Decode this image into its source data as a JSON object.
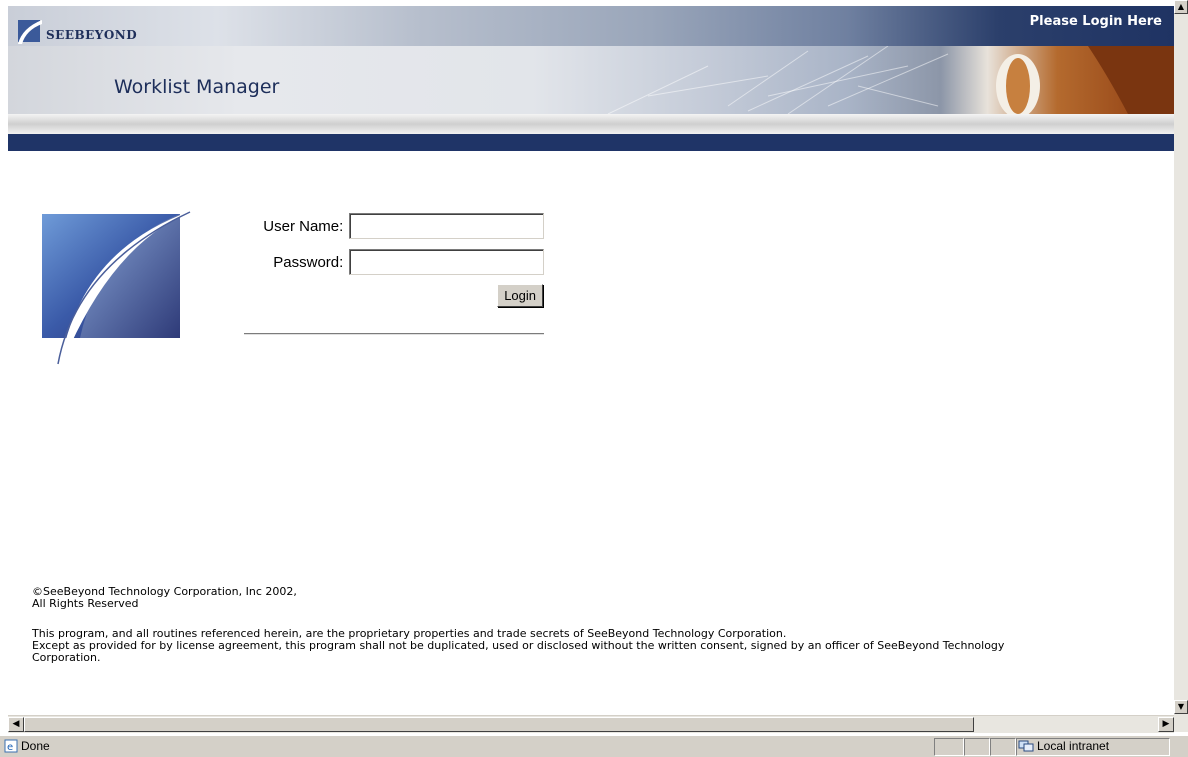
{
  "header": {
    "brand": "SEEBEYOND",
    "login_prompt": "Please Login Here",
    "app_title": "Worklist Manager"
  },
  "login_form": {
    "username_label": "User Name:",
    "username_value": "",
    "password_label": "Password:",
    "password_value": "",
    "login_button": "Login"
  },
  "footer": {
    "copyright_line1": "©SeeBeyond Technology Corporation, Inc 2002,",
    "copyright_line2": "All Rights Reserved",
    "legal_line1": "This program, and all routines referenced herein, are the proprietary properties and trade secrets of SeeBeyond Technology Corporation.",
    "legal_line2": "Except as provided for by license agreement, this program shall not be duplicated, used or disclosed without the written consent, signed by an officer of SeeBeyond Technology",
    "legal_line3": "Corporation."
  },
  "status_bar": {
    "status_text": "Done",
    "zone_text": "Local intranet"
  },
  "colors": {
    "navy": "#1f3467",
    "brand_text": "#1d2e5a",
    "accent_orange": "#b46a2e"
  },
  "icons": [
    "seebeyond-logo-icon",
    "ie-page-icon",
    "intranet-zone-icon",
    "scroll-left-icon",
    "scroll-right-icon",
    "scroll-up-icon",
    "scroll-down-icon"
  ]
}
